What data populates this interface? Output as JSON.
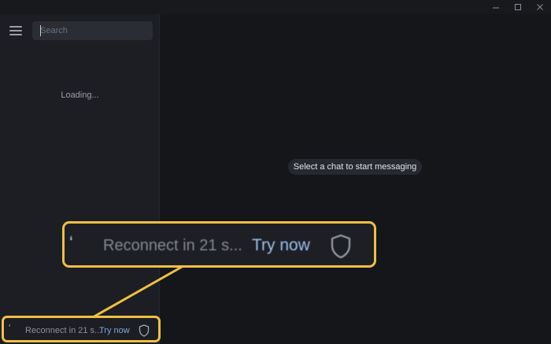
{
  "window": {
    "minimize_icon": "minimize-icon",
    "maximize_icon": "maximize-icon",
    "close_icon": "close-icon"
  },
  "sidebar": {
    "menu_icon": "hamburger-menu-icon",
    "search": {
      "placeholder": "Search",
      "value": ""
    },
    "loading_text": "Loading..."
  },
  "status": {
    "reconnect_text": "Reconnect in 21 s...",
    "try_now_label": "Try now",
    "shield_icon": "shield-icon"
  },
  "callout_zoom": {
    "reconnect_text": "Reconnect in 21 s...",
    "try_now_label": "Try now"
  },
  "main": {
    "empty_state_text": "Select a chat to start messaging"
  },
  "colors": {
    "accent": "#f0c043",
    "link": "#7da6dd",
    "sidebar_bg": "#1c1e23",
    "main_bg": "#14161a"
  }
}
